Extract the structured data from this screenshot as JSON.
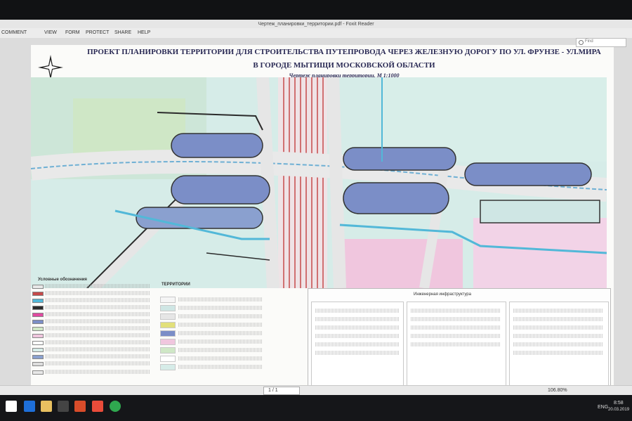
{
  "window": {
    "title": "Чертеж_планировки_территории.pdf - Foxit Reader"
  },
  "menu": {
    "items": [
      "COMMENT",
      "VIEW",
      "FORM",
      "PROTECT",
      "SHARE",
      "HELP"
    ]
  },
  "search": {
    "placeholder": "Find"
  },
  "document": {
    "title_line1": "ПРОЕКТ ПЛАНИРОВКИ ТЕРРИТОРИИ ДЛЯ СТРОИТЕЛЬСТВА ПУТЕПРОВОДА ЧЕРЕЗ ЖЕЛЕЗНУЮ ДОРОГУ ПО УЛ. ФРУНЗЕ - УЛ.МИРА",
    "title_line2": "В ГОРОДЕ МЫТИЩИ МОСКОВСКОЙ ОБЛАСТИ",
    "subtitle": "Чертеж планировки территории. М 1:1000",
    "legend_left_title": "Условные обозначения",
    "legend_mid_title": "ТЕРРИТОРИИ",
    "legend_right_title": "Инженерная инфраструктура"
  },
  "status": {
    "page": "1 / 1",
    "zoom": "106.80%"
  },
  "taskbar": {
    "language": "ENG",
    "time": "8:58",
    "date": "20.03.2019"
  },
  "colors": {
    "road": "#e8e8e8",
    "rail": "#c64a4a",
    "water": "#52b8d8",
    "zone_pink": "#f0c6de",
    "zone_green": "#c8dfbe",
    "zone_blue": "#6b84c8",
    "boundary": "#2b2b2b"
  }
}
